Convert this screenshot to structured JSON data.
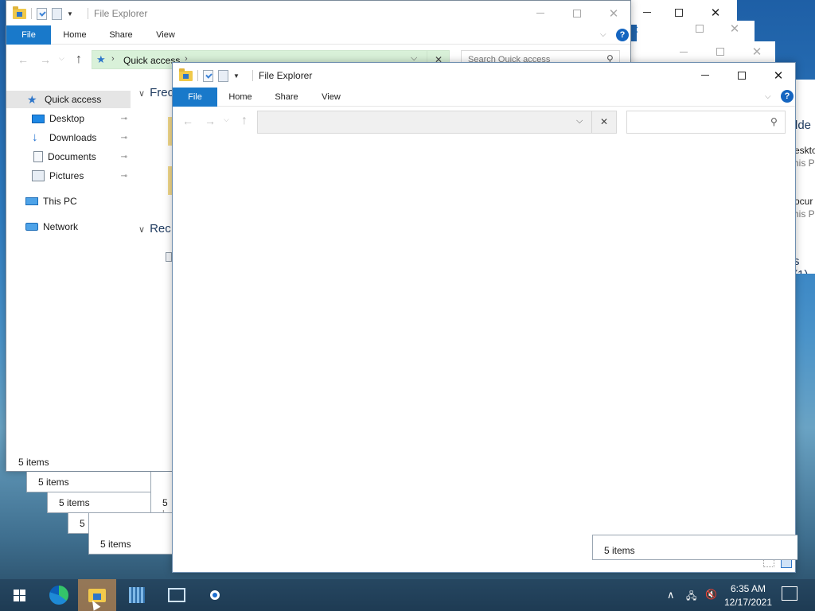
{
  "windows": {
    "back": {
      "title": "File Explorer",
      "tabs": [
        "File",
        "Home",
        "Share",
        "View"
      ],
      "address": "Quick access",
      "search_placeholder": "Search Quick access",
      "nav_items": [
        {
          "label": "Quick access",
          "icon": "star-icon",
          "pinned": false,
          "selected": true
        },
        {
          "label": "Desktop",
          "icon": "desktop-icon",
          "pinned": true
        },
        {
          "label": "Downloads",
          "icon": "download-icon",
          "pinned": true
        },
        {
          "label": "Documents",
          "icon": "documents-icon",
          "pinned": true
        },
        {
          "label": "Pictures",
          "icon": "pictures-icon",
          "pinned": true
        },
        {
          "label": "This PC",
          "icon": "pc-icon",
          "pinned": false
        },
        {
          "label": "Network",
          "icon": "network-icon",
          "pinned": false
        }
      ],
      "section_frequent": "Frec",
      "section_recent": "Rec",
      "status": "5 items"
    },
    "cascade_status": [
      "5 items",
      "5 items",
      "5 i",
      "5"
    ],
    "front": {
      "title": "File Explorer",
      "tabs": [
        "File",
        "Home",
        "Share",
        "View"
      ],
      "status": "5 items"
    },
    "status_middle": "5 items",
    "status_right": "5 items",
    "peek_right": {
      "header": "lde",
      "item1": "eskto",
      "item1_sub": "his P",
      "item2": "ocur",
      "item2_sub": "his P",
      "recent": "s (1)"
    }
  },
  "taskbar": {
    "time": "6:35 AM",
    "date": "12/17/2021",
    "apps": [
      "windows-start-icon",
      "edge-icon",
      "file-explorer-icon",
      "server-manager-icon",
      "network-share-icon",
      "cortana-icon"
    ]
  },
  "colors": {
    "accent": "#1979ca",
    "address_quick_access": "#d9f1d9",
    "selected_nav": "#e5e5e5"
  }
}
